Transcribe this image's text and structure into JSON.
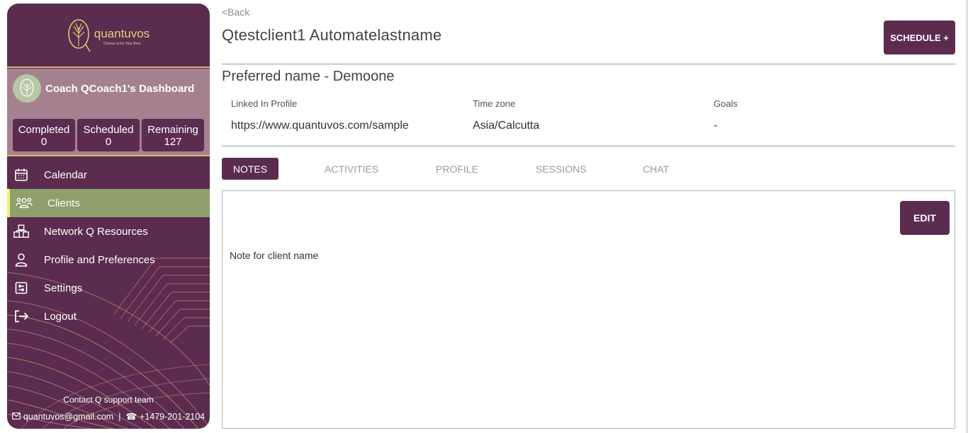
{
  "brand": {
    "name": "quantuvos",
    "tagline": "Choose to be Your Best",
    "primary_color": "#5b2c4f",
    "active_color": "#8ea06c",
    "accent_gold": "#e6cf6e"
  },
  "dashboard": {
    "title": "Coach QCoach1's Dashboard",
    "stats": [
      {
        "label": "Completed",
        "value": "0"
      },
      {
        "label": "Scheduled",
        "value": "0"
      },
      {
        "label": "Remaining",
        "value": "127"
      }
    ]
  },
  "menu": [
    {
      "label": "Calendar",
      "icon": "calendar-icon"
    },
    {
      "label": "Clients",
      "icon": "users-icon",
      "active": true
    },
    {
      "label": "Network Q Resources",
      "icon": "network-icon"
    },
    {
      "label": "Profile and Preferences",
      "icon": "person-icon"
    },
    {
      "label": "Settings",
      "icon": "settings-icon"
    },
    {
      "label": "Logout",
      "icon": "logout-icon"
    }
  ],
  "support": {
    "title": "Contact Q support team",
    "email": "quantuvos@gmail.com",
    "phone": "+1479-201-2104"
  },
  "header": {
    "back": "<Back",
    "client_name": "Qtestclient1 Automatelastname",
    "schedule_button": "SCHEDULE +"
  },
  "client": {
    "preferred": "Preferred name  - Demoone",
    "fields": [
      {
        "label": "Linked In Profile",
        "value": "https://www.quantuvos.com/sample"
      },
      {
        "label": "Time zone",
        "value": "Asia/Calcutta"
      },
      {
        "label": "Goals",
        "value": "-"
      }
    ]
  },
  "tabs": [
    "NOTES",
    "ACTIVITIES",
    "PROFILE",
    "SESSIONS",
    "CHAT"
  ],
  "notes": {
    "edit_button": "EDIT",
    "text": "Note for client name"
  }
}
